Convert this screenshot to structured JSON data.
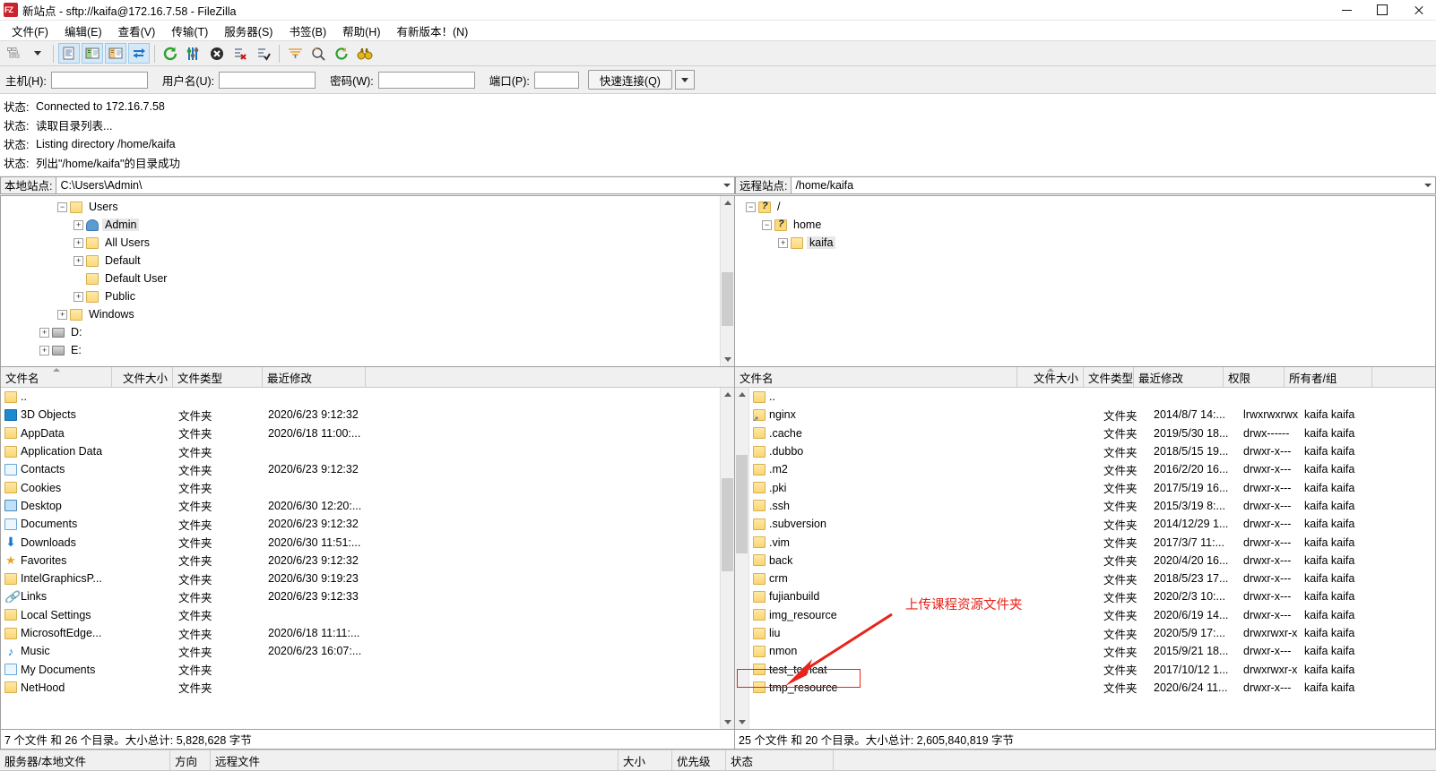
{
  "window": {
    "title": "新站点 - sftp://kaifa@172.16.7.58 - FileZilla",
    "app_icon": "filezilla-icon",
    "minimize": "—",
    "maximize": "□",
    "close": "✕"
  },
  "menu": [
    {
      "label": "文件(F)",
      "name": "menu-file"
    },
    {
      "label": "编辑(E)",
      "name": "menu-edit"
    },
    {
      "label": "查看(V)",
      "name": "menu-view"
    },
    {
      "label": "传输(T)",
      "name": "menu-transfer"
    },
    {
      "label": "服务器(S)",
      "name": "menu-server"
    },
    {
      "label": "书签(B)",
      "name": "menu-bookmarks"
    },
    {
      "label": "帮助(H)",
      "name": "menu-help"
    },
    {
      "label": "有新版本！(N)",
      "name": "menu-new-version"
    }
  ],
  "toolbar": [
    {
      "name": "site-manager-icon",
      "glyph": "sitemanager"
    },
    {
      "name": "site-manager-dropdown-icon",
      "glyph": "caret"
    },
    {
      "name": "toggle-message-log-icon",
      "glyph": "msglog",
      "active": true
    },
    {
      "name": "toggle-local-tree-icon",
      "glyph": "localtree",
      "active": true
    },
    {
      "name": "toggle-remote-tree-icon",
      "glyph": "remotetree",
      "active": true
    },
    {
      "name": "toggle-transfer-queue-icon",
      "glyph": "queue",
      "active": true
    },
    {
      "name": "refresh-icon",
      "glyph": "refresh"
    },
    {
      "name": "process-queue-icon",
      "glyph": "processqueue"
    },
    {
      "name": "cancel-operation-icon",
      "glyph": "cancel"
    },
    {
      "name": "disconnect-icon",
      "glyph": "disconnect"
    },
    {
      "name": "reconnect-icon",
      "glyph": "reconnect"
    },
    {
      "name": "filter-icon",
      "glyph": "filter"
    },
    {
      "name": "directory-comparison-icon",
      "glyph": "compare"
    },
    {
      "name": "synchronized-browsing-icon",
      "glyph": "sync"
    },
    {
      "name": "search-remote-files-icon",
      "glyph": "binoculars"
    }
  ],
  "quickconnect": {
    "host_label": "主机(H):",
    "host_value": "",
    "user_label": "用户名(U):",
    "user_value": "",
    "pass_label": "密码(W):",
    "pass_value": "",
    "port_label": "端口(P):",
    "port_value": "",
    "button_label": "快速连接(Q)",
    "dropdown_icon": "chevron-down-icon"
  },
  "log": {
    "rows": [
      {
        "key": "状态:",
        "msg": "Connected to 172.16.7.58"
      },
      {
        "key": "状态:",
        "msg": "读取目录列表..."
      },
      {
        "key": "状态:",
        "msg": "Listing directory /home/kaifa"
      },
      {
        "key": "状态:",
        "msg": "列出\"/home/kaifa\"的目录成功"
      }
    ]
  },
  "local": {
    "site_label": "本地站点:",
    "site_path": "C:\\Users\\Admin\\",
    "tree": [
      {
        "label": "Users",
        "indent": 1,
        "expander": "-",
        "icon": "folder"
      },
      {
        "label": "Admin",
        "indent": 2,
        "expander": "+",
        "icon": "user"
      },
      {
        "label": "All Users",
        "indent": 2,
        "expander": "+",
        "icon": "folder"
      },
      {
        "label": "Default",
        "indent": 2,
        "expander": "+",
        "icon": "folder"
      },
      {
        "label": "Default User",
        "indent": 2,
        "expander": "",
        "icon": "folder"
      },
      {
        "label": "Public",
        "indent": 2,
        "expander": "+",
        "icon": "folder"
      },
      {
        "label": "Windows",
        "indent": 1,
        "expander": "+",
        "icon": "folder"
      },
      {
        "label": "D:",
        "indent": 0,
        "expander": "+",
        "icon": "drive"
      },
      {
        "label": "E:",
        "indent": 0,
        "expander": "+",
        "icon": "drive"
      }
    ],
    "columns": [
      "文件名",
      "文件大小",
      "文件类型",
      "最近修改"
    ],
    "rows": [
      {
        "name": "..",
        "icon": "folder",
        "size": "",
        "type": "",
        "modified": ""
      },
      {
        "name": "3D Objects",
        "icon": "cube",
        "size": "",
        "type": "文件夹",
        "modified": "2020/6/23 9:12:32"
      },
      {
        "name": "AppData",
        "icon": "folder",
        "size": "",
        "type": "文件夹",
        "modified": "2020/6/18 11:00:..."
      },
      {
        "name": "Application Data",
        "icon": "folder",
        "size": "",
        "type": "文件夹",
        "modified": ""
      },
      {
        "name": "Contacts",
        "icon": "card",
        "size": "",
        "type": "文件夹",
        "modified": "2020/6/23 9:12:32"
      },
      {
        "name": "Cookies",
        "icon": "folder",
        "size": "",
        "type": "文件夹",
        "modified": ""
      },
      {
        "name": "Desktop",
        "icon": "screen",
        "size": "",
        "type": "文件夹",
        "modified": "2020/6/30 12:20:..."
      },
      {
        "name": "Documents",
        "icon": "doc",
        "size": "",
        "type": "文件夹",
        "modified": "2020/6/23 9:12:32"
      },
      {
        "name": "Downloads",
        "icon": "dl",
        "size": "",
        "type": "文件夹",
        "modified": "2020/6/30 11:51:..."
      },
      {
        "name": "Favorites",
        "icon": "star",
        "size": "",
        "type": "文件夹",
        "modified": "2020/6/23 9:12:32"
      },
      {
        "name": "IntelGraphicsP...",
        "icon": "folder",
        "size": "",
        "type": "文件夹",
        "modified": "2020/6/30 9:19:23"
      },
      {
        "name": "Links",
        "icon": "lnk",
        "size": "",
        "type": "文件夹",
        "modified": "2020/6/23 9:12:33"
      },
      {
        "name": "Local Settings",
        "icon": "folder",
        "size": "",
        "type": "文件夹",
        "modified": ""
      },
      {
        "name": "MicrosoftEdge...",
        "icon": "folder",
        "size": "",
        "type": "文件夹",
        "modified": "2020/6/18 11:11:..."
      },
      {
        "name": "Music",
        "icon": "music",
        "size": "",
        "type": "文件夹",
        "modified": "2020/6/23 16:07:..."
      },
      {
        "name": "My Documents",
        "icon": "doc",
        "size": "",
        "type": "文件夹",
        "modified": ""
      },
      {
        "name": "NetHood",
        "icon": "folder",
        "size": "",
        "type": "文件夹",
        "modified": ""
      }
    ],
    "status": "7 个文件 和 26 个目录。大小总计: 5,828,628 字节"
  },
  "remote": {
    "site_label": "远程站点:",
    "site_path": "/home/kaifa",
    "tree": [
      {
        "label": "/",
        "indent": 0,
        "expander": "-",
        "icon": "folderq"
      },
      {
        "label": "home",
        "indent": 1,
        "expander": "-",
        "icon": "folderq"
      },
      {
        "label": "kaifa",
        "indent": 2,
        "expander": "+",
        "icon": "folder"
      }
    ],
    "columns": [
      "文件名",
      "文件大小",
      "文件类型",
      "最近修改",
      "权限",
      "所有者/组"
    ],
    "rows": [
      {
        "name": "..",
        "icon": "folder",
        "size": "",
        "type": "",
        "modified": "",
        "perm": "",
        "owner": ""
      },
      {
        "name": "nginx",
        "icon": "link",
        "size": "",
        "type": "文件夹",
        "modified": "2014/8/7 14:...",
        "perm": "lrwxrwxrwx",
        "owner": "kaifa kaifa"
      },
      {
        "name": ".cache",
        "icon": "folder",
        "size": "",
        "type": "文件夹",
        "modified": "2019/5/30 18...",
        "perm": "drwx------",
        "owner": "kaifa kaifa"
      },
      {
        "name": ".dubbo",
        "icon": "folder",
        "size": "",
        "type": "文件夹",
        "modified": "2018/5/15 19...",
        "perm": "drwxr-x---",
        "owner": "kaifa kaifa"
      },
      {
        "name": ".m2",
        "icon": "folder",
        "size": "",
        "type": "文件夹",
        "modified": "2016/2/20 16...",
        "perm": "drwxr-x---",
        "owner": "kaifa kaifa"
      },
      {
        "name": ".pki",
        "icon": "folder",
        "size": "",
        "type": "文件夹",
        "modified": "2017/5/19 16...",
        "perm": "drwxr-x---",
        "owner": "kaifa kaifa"
      },
      {
        "name": ".ssh",
        "icon": "folder",
        "size": "",
        "type": "文件夹",
        "modified": "2015/3/19 8:...",
        "perm": "drwxr-x---",
        "owner": "kaifa kaifa"
      },
      {
        "name": ".subversion",
        "icon": "folder",
        "size": "",
        "type": "文件夹",
        "modified": "2014/12/29 1...",
        "perm": "drwxr-x---",
        "owner": "kaifa kaifa"
      },
      {
        "name": ".vim",
        "icon": "folder",
        "size": "",
        "type": "文件夹",
        "modified": "2017/3/7 11:...",
        "perm": "drwxr-x---",
        "owner": "kaifa kaifa"
      },
      {
        "name": "back",
        "icon": "folder",
        "size": "",
        "type": "文件夹",
        "modified": "2020/4/20 16...",
        "perm": "drwxr-x---",
        "owner": "kaifa kaifa"
      },
      {
        "name": "crm",
        "icon": "folder",
        "size": "",
        "type": "文件夹",
        "modified": "2018/5/23 17...",
        "perm": "drwxr-x---",
        "owner": "kaifa kaifa"
      },
      {
        "name": "fujianbuild",
        "icon": "folder",
        "size": "",
        "type": "文件夹",
        "modified": "2020/2/3 10:...",
        "perm": "drwxr-x---",
        "owner": "kaifa kaifa"
      },
      {
        "name": "img_resource",
        "icon": "folder",
        "size": "",
        "type": "文件夹",
        "modified": "2020/6/19 14...",
        "perm": "drwxr-x---",
        "owner": "kaifa kaifa"
      },
      {
        "name": "liu",
        "icon": "folder",
        "size": "",
        "type": "文件夹",
        "modified": "2020/5/9 17:...",
        "perm": "drwxrwxr-x",
        "owner": "kaifa kaifa"
      },
      {
        "name": "nmon",
        "icon": "folder",
        "size": "",
        "type": "文件夹",
        "modified": "2015/9/21 18...",
        "perm": "drwxr-x---",
        "owner": "kaifa kaifa"
      },
      {
        "name": "test_tomcat",
        "icon": "folder",
        "size": "",
        "type": "文件夹",
        "modified": "2017/10/12 1...",
        "perm": "drwxrwxr-x",
        "owner": "kaifa kaifa"
      },
      {
        "name": "tmp_resource",
        "icon": "folder",
        "size": "",
        "type": "文件夹",
        "modified": "2020/6/24 11...",
        "perm": "drwxr-x---",
        "owner": "kaifa kaifa"
      }
    ],
    "status": "25 个文件 和 20 个目录。大小总计: 2,605,840,819 字节"
  },
  "annotation": {
    "text": "上传课程资源文件夹",
    "color": "#e8231a",
    "target_row": "tmp_resource"
  },
  "queue": {
    "columns": [
      "服务器/本地文件",
      "方向",
      "远程文件",
      "",
      "大小",
      "优先级",
      "状态"
    ]
  }
}
